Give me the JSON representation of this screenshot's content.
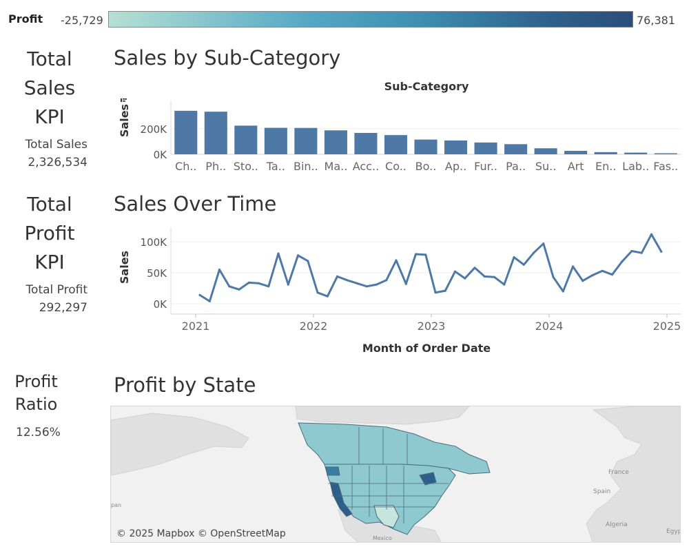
{
  "legend": {
    "title": "Profit",
    "min_label": "-25,729",
    "max_label": "76,381",
    "colors": [
      "#b6e0d4",
      "#2a4f7a"
    ]
  },
  "kpis": {
    "sales": {
      "title_lines": [
        "Total",
        "Sales",
        "KPI"
      ],
      "label": "Total Sales",
      "value": "2,326,534"
    },
    "profit": {
      "title_lines": [
        "Total",
        "Profit",
        "KPI"
      ],
      "label": "Total Profit",
      "value": "292,297"
    },
    "ratio": {
      "title_lines": [
        "Profit",
        "Ratio"
      ],
      "value": "12.56%"
    }
  },
  "sections": {
    "subcategory_title": "Sales by Sub-Category",
    "time_title": "Sales Over Time",
    "state_title": "Profit by State"
  },
  "map": {
    "attribution": "© 2025 Mapbox © OpenStreetMap",
    "place_labels": [
      "France",
      "Spain",
      "Algeria",
      "Egypt",
      "Mexico",
      "pan"
    ],
    "land_color": "#e0e0e0",
    "water_color": "#f1f1f1",
    "region_color": "#8fc9d0"
  },
  "chart_data": [
    {
      "type": "bar",
      "title": "Sub-Category",
      "ylabel": "Sales",
      "ylim": [
        0,
        420000
      ],
      "y_ticks": [
        0,
        200000
      ],
      "y_tick_labels": [
        "0K",
        "200K"
      ],
      "categories": [
        "Ch..",
        "Ph..",
        "Sto..",
        "Ta..",
        "Bin..",
        "Ma..",
        "Acc..",
        "Co..",
        "Bo..",
        "Ap..",
        "Fur..",
        "Pa..",
        "Su..",
        "Art",
        "En..",
        "Lab..",
        "Fas.."
      ],
      "values": [
        340000,
        333000,
        224000,
        207000,
        206000,
        187000,
        167000,
        150000,
        115000,
        108000,
        92000,
        79000,
        47000,
        27000,
        17000,
        13000,
        8000
      ],
      "color": "#4e79a7"
    },
    {
      "type": "line",
      "xlabel": "Month of Order Date",
      "ylabel": "Sales",
      "ylim": [
        0,
        120000
      ],
      "y_ticks": [
        0,
        50000,
        100000
      ],
      "y_tick_labels": [
        "0K",
        "50K",
        "100K"
      ],
      "x_tick_labels": [
        "2021",
        "2022",
        "2023",
        "2024",
        "2025"
      ],
      "x": [
        "2021-01",
        "2021-02",
        "2021-03",
        "2021-04",
        "2021-05",
        "2021-06",
        "2021-07",
        "2021-08",
        "2021-09",
        "2021-10",
        "2021-11",
        "2021-12",
        "2022-01",
        "2022-02",
        "2022-03",
        "2022-04",
        "2022-05",
        "2022-06",
        "2022-07",
        "2022-08",
        "2022-09",
        "2022-10",
        "2022-11",
        "2022-12",
        "2023-01",
        "2023-02",
        "2023-03",
        "2023-04",
        "2023-05",
        "2023-06",
        "2023-07",
        "2023-08",
        "2023-09",
        "2023-10",
        "2023-11",
        "2023-12",
        "2024-01",
        "2024-02",
        "2024-03",
        "2024-04",
        "2024-05",
        "2024-06",
        "2024-07",
        "2024-08",
        "2024-09",
        "2024-10",
        "2024-11",
        "2024-12"
      ],
      "series": [
        {
          "values": [
            14000,
            4000,
            55000,
            28000,
            23000,
            34000,
            33000,
            28000,
            81000,
            31000,
            78000,
            69000,
            18000,
            12000,
            44000,
            38000,
            33000,
            28000,
            31000,
            38000,
            70000,
            32000,
            80000,
            79000,
            18000,
            21000,
            52000,
            41000,
            58000,
            44000,
            43000,
            31000,
            75000,
            63000,
            82000,
            97000,
            43000,
            20000,
            60000,
            37000,
            46000,
            53000,
            47000,
            68000,
            85000,
            82000,
            112000,
            84000
          ]
        }
      ],
      "color": "#4e79a7"
    }
  ]
}
